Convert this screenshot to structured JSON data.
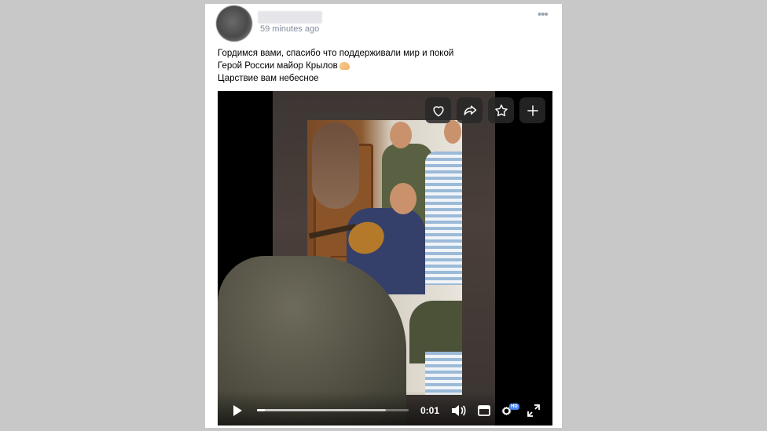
{
  "post": {
    "author_name": "",
    "time": "59 minutes ago",
    "lines": [
      "Гордимся вами, спасибо что поддерживали мир и покой",
      "Герой России майор Крылов",
      "Царствие вам небесное"
    ],
    "emoji": "flexed-biceps-icon"
  },
  "video": {
    "actions": [
      "heart-icon",
      "share-icon",
      "star-icon",
      "plus-icon"
    ],
    "timecode": "0:01",
    "progress": 0.05,
    "buffered": 0.85,
    "quality_badge": "HD"
  },
  "colors": {
    "background": "#c8c8c8",
    "card": "#ffffff",
    "meta_text": "#818c99",
    "accent": "#4a86f0"
  }
}
